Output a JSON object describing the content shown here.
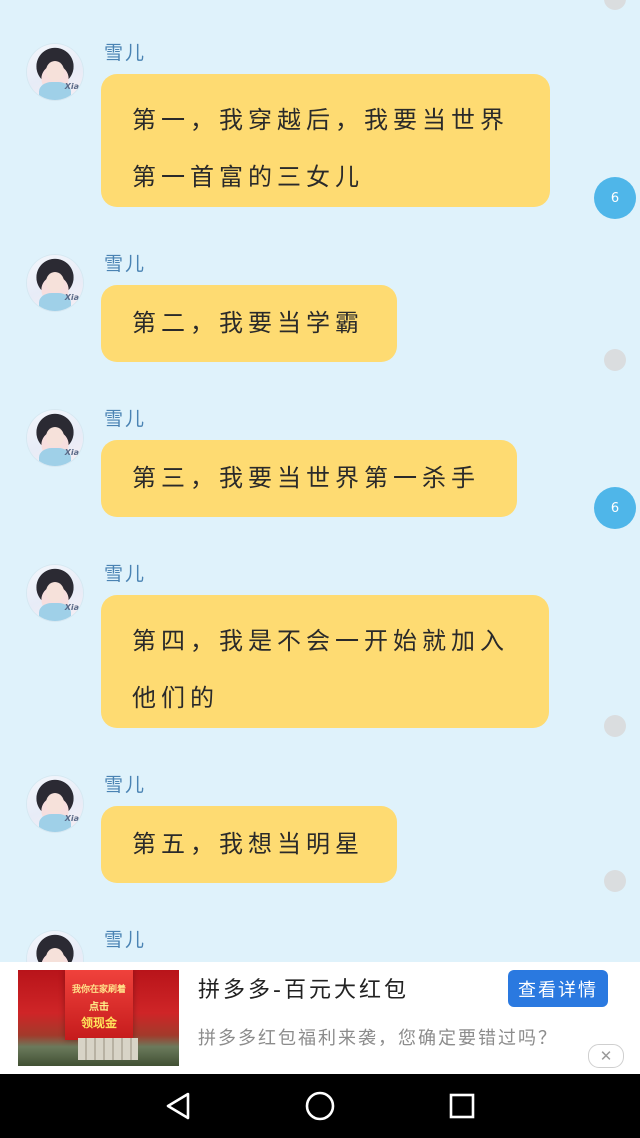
{
  "messages": [
    {
      "sender": "雪儿",
      "lines": [
        "第一，我穿越后，我要当世界",
        "第一首富的三女儿"
      ],
      "status": "badge",
      "badge_text": "6"
    },
    {
      "sender": "雪儿",
      "lines": [
        "第二，我要当学霸"
      ],
      "status": "dot"
    },
    {
      "sender": "雪儿",
      "lines": [
        "第三，我要当世界第一杀手"
      ],
      "status": "badge",
      "badge_text": "6"
    },
    {
      "sender": "雪儿",
      "lines": [
        "第四，我是不会一开始就加入",
        "他们的"
      ],
      "status": "dot"
    },
    {
      "sender": "雪儿",
      "lines": [
        "第五，我想当明星"
      ],
      "status": "dot"
    },
    {
      "sender": "雪儿",
      "lines": [],
      "status": "none"
    }
  ],
  "ad": {
    "image_text": [
      "我你在家刷着",
      "点击",
      "领现金"
    ],
    "title": "拼多多-百元大红包",
    "description": "拼多多红包福利来袭，您确定要错过吗？",
    "button_label": "查看详情",
    "close_icon": "close-icon"
  },
  "navbar": {
    "icons": [
      "back-icon",
      "home-icon",
      "recents-icon"
    ]
  },
  "colors": {
    "background": "#dff2fb",
    "bubble": "#fedb72",
    "badge": "#4fb6e9",
    "name": "#4a83b3",
    "ad_button": "#2a79e0"
  }
}
